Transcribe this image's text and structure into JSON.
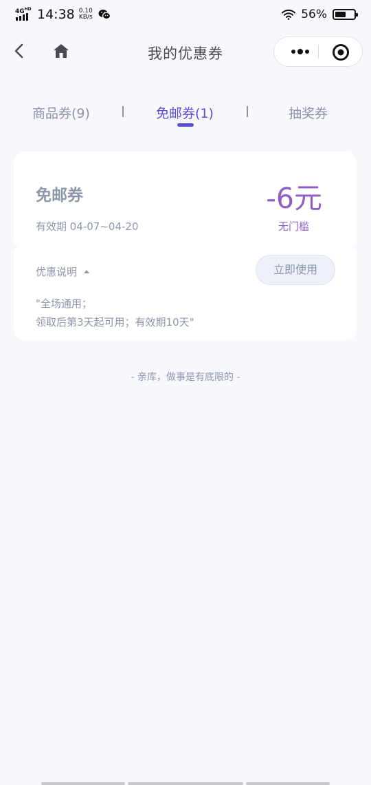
{
  "status_bar": {
    "network": "4G HD",
    "time": "14:38",
    "speed_value": "0.10",
    "speed_unit": "KB/s",
    "battery_percent": "56%",
    "battery_level": 0.56
  },
  "nav": {
    "title": "我的优惠券"
  },
  "tabs": [
    {
      "label": "商品券(9)",
      "active": false
    },
    {
      "label": "免邮券(1)",
      "active": true
    },
    {
      "label": "抽奖券",
      "active": false
    }
  ],
  "coupon": {
    "name": "免邮券",
    "validity": "有效期 04-07~04-20",
    "amount": "-6元",
    "threshold": "无门槛",
    "desc_toggle_label": "优惠说明",
    "use_button_label": "立即使用",
    "desc_line1": "\"全场通用；",
    "desc_line2": "领取后第3天起可用；有效期10天\""
  },
  "footer_note": "- 亲库，做事是有底限的 -",
  "colors": {
    "accent": "#5a4ed8",
    "amount": "#8f5ec8",
    "muted_text": "#8d96ab",
    "background": "#f8f8fc"
  }
}
